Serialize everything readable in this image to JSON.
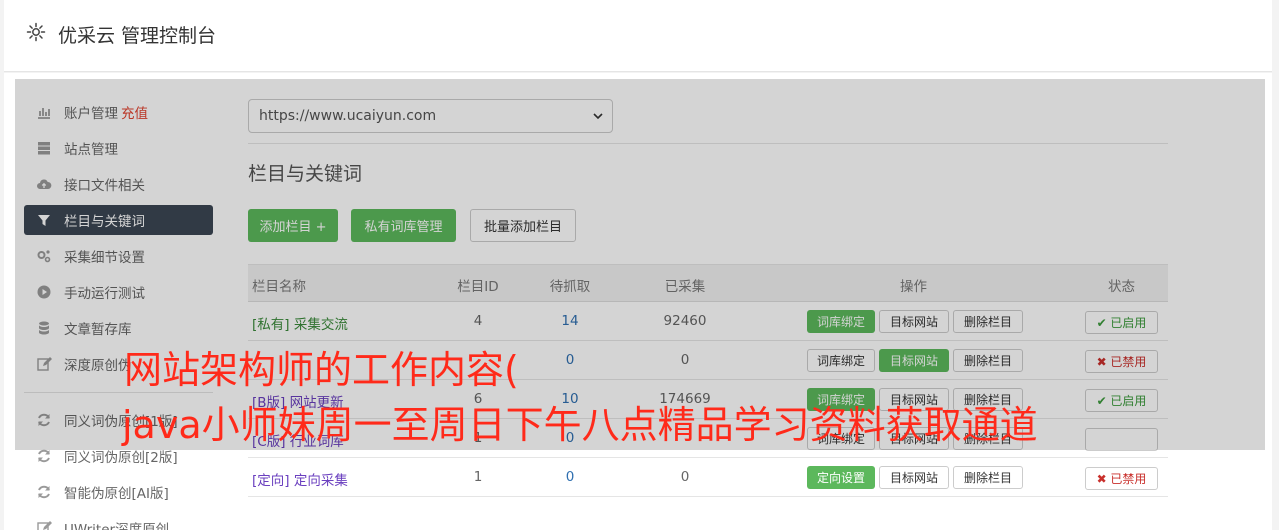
{
  "header": {
    "title": "优采云 管理控制台"
  },
  "sidebar": {
    "items": [
      {
        "label": "账户管理",
        "badge": "充值",
        "icon": "bar-chart-icon"
      },
      {
        "label": "站点管理",
        "icon": "server-icon"
      },
      {
        "label": "接口文件相关",
        "icon": "cloud-upload-icon"
      },
      {
        "label": "栏目与关键词",
        "icon": "filter-icon",
        "active": true
      },
      {
        "label": "采集细节设置",
        "icon": "gears-icon"
      },
      {
        "label": "手动运行测试",
        "icon": "play-circle-icon"
      },
      {
        "label": "文章暂存库",
        "icon": "database-icon"
      },
      {
        "label": "深度原创伪",
        "icon": "edit-icon"
      },
      {
        "label": "同义词伪原创[1版]",
        "icon": "refresh-icon"
      },
      {
        "label": "同义词伪原创[2版]",
        "icon": "refresh-icon"
      },
      {
        "label": "智能伪原创[AI版]",
        "icon": "refresh-icon"
      },
      {
        "label": "UWriter深度原创",
        "icon": "edit-icon"
      }
    ]
  },
  "main": {
    "site_select": "https://www.ucaiyun.com",
    "section_title": "栏目与关键词",
    "buttons": {
      "add": "添加栏目 +",
      "private_lib": "私有词库管理",
      "batch_add": "批量添加栏目"
    },
    "table": {
      "headers": {
        "name": "栏目名称",
        "id": "栏目ID",
        "pending": "待抓取",
        "collected": "已采集",
        "ops": "操作",
        "status": "状态"
      },
      "op_labels": {
        "bind": "词库绑定",
        "target": "目标网站",
        "delete": "删除栏目",
        "direct": "定向设置"
      },
      "rows": [
        {
          "tag": "[私有]",
          "name": "采集交流",
          "id": "4",
          "pending": "14",
          "collected": "92460",
          "status": "✔ 已启用"
        },
        {
          "tag": "",
          "name": "",
          "id": "",
          "pending": "0",
          "collected": "0",
          "status": "✖ 已禁用"
        },
        {
          "tag": "[B版]",
          "name": "网站更新",
          "id": "6",
          "pending": "10",
          "collected": "174669",
          "status": "✔ 已启用"
        },
        {
          "tag": "[C版]",
          "name": "行业词库",
          "id": "1",
          "pending": "0",
          "collected": "",
          "status": ""
        },
        {
          "tag": "[定向]",
          "name": "定向采集",
          "id": "1",
          "pending": "0",
          "collected": "0",
          "status": "✖ 已禁用"
        }
      ]
    }
  },
  "watermark": {
    "line1": "网站架构师的工作内容(",
    "line2": "java小师妹周一至周日下午八点精品学习资料获取通道"
  }
}
